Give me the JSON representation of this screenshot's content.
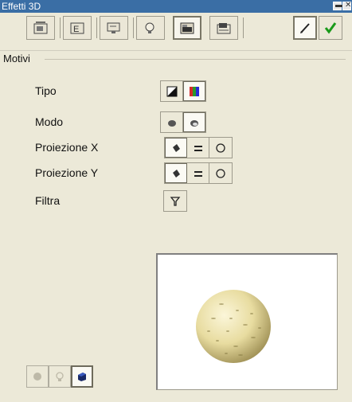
{
  "window": {
    "title": "Effetti 3D"
  },
  "toolbar": {
    "buttons": [
      {
        "icon": "geometry-icon",
        "active": false
      },
      {
        "icon": "shading-icon",
        "active": false
      },
      {
        "icon": "illumination-icon",
        "active": false
      },
      {
        "icon": "lighting-icon",
        "active": false
      },
      {
        "icon": "textures-icon",
        "active": true
      },
      {
        "icon": "material-icon",
        "active": false
      }
    ],
    "right": [
      {
        "icon": "edit-pen-icon"
      },
      {
        "icon": "apply-checkmark-icon"
      }
    ]
  },
  "section": {
    "label": "Motivi"
  },
  "rows": [
    {
      "label": "Tipo"
    },
    {
      "label": "Modo"
    },
    {
      "label": "Proiezione X"
    },
    {
      "label": "Proiezione Y"
    },
    {
      "label": "Filtra"
    }
  ],
  "colors": {
    "titlebar": "#3a6ea5",
    "sphere": "#e8dca0",
    "apply_green": "#1a9a1a"
  }
}
